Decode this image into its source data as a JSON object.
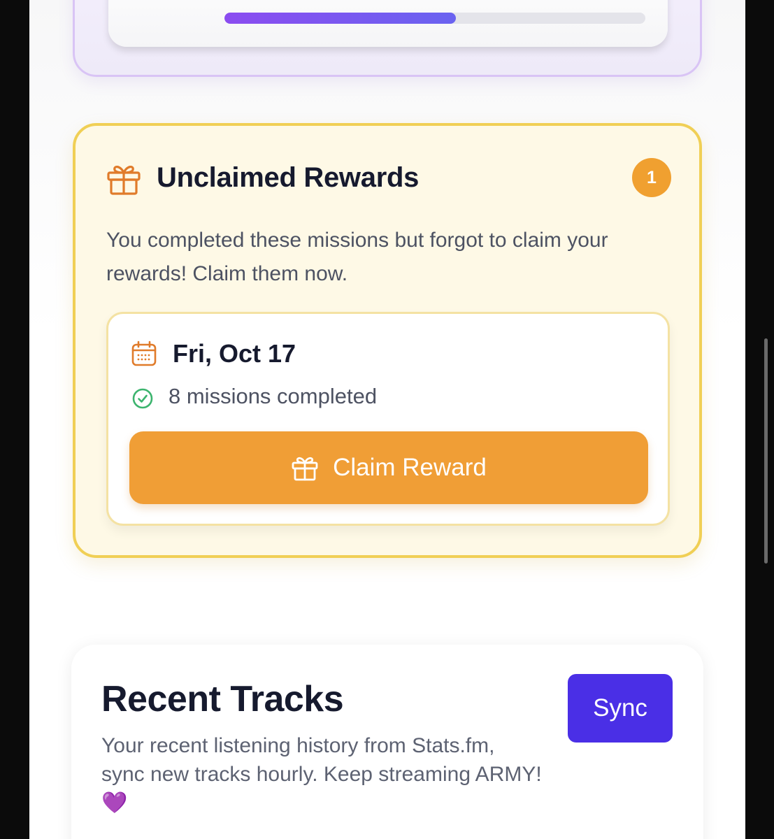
{
  "progress": {
    "fraction": 0.55
  },
  "unclaimed_rewards": {
    "title": "Unclaimed Rewards",
    "badge_count": "1",
    "description": "You completed these missions but forgot to claim your rewards! Claim them now.",
    "items": [
      {
        "date": "Fri, Oct 17",
        "missions_label": "8 missions completed",
        "claim_label": "Claim Reward"
      }
    ]
  },
  "recent_tracks": {
    "title": "Recent Tracks",
    "description": "Your recent listening history from Stats.fm, sync new tracks hourly. Keep streaming ARMY! 💜",
    "sync_label": "Sync"
  },
  "colors": {
    "accent_orange": "#f09e36",
    "card_border_yellow": "#f0cf55",
    "sync_purple": "#4a2fe6",
    "progress_purple": "#8b4cf0",
    "success_green": "#3cb46e"
  },
  "icons": [
    "gift-icon",
    "calendar-icon",
    "check-circle-icon"
  ]
}
